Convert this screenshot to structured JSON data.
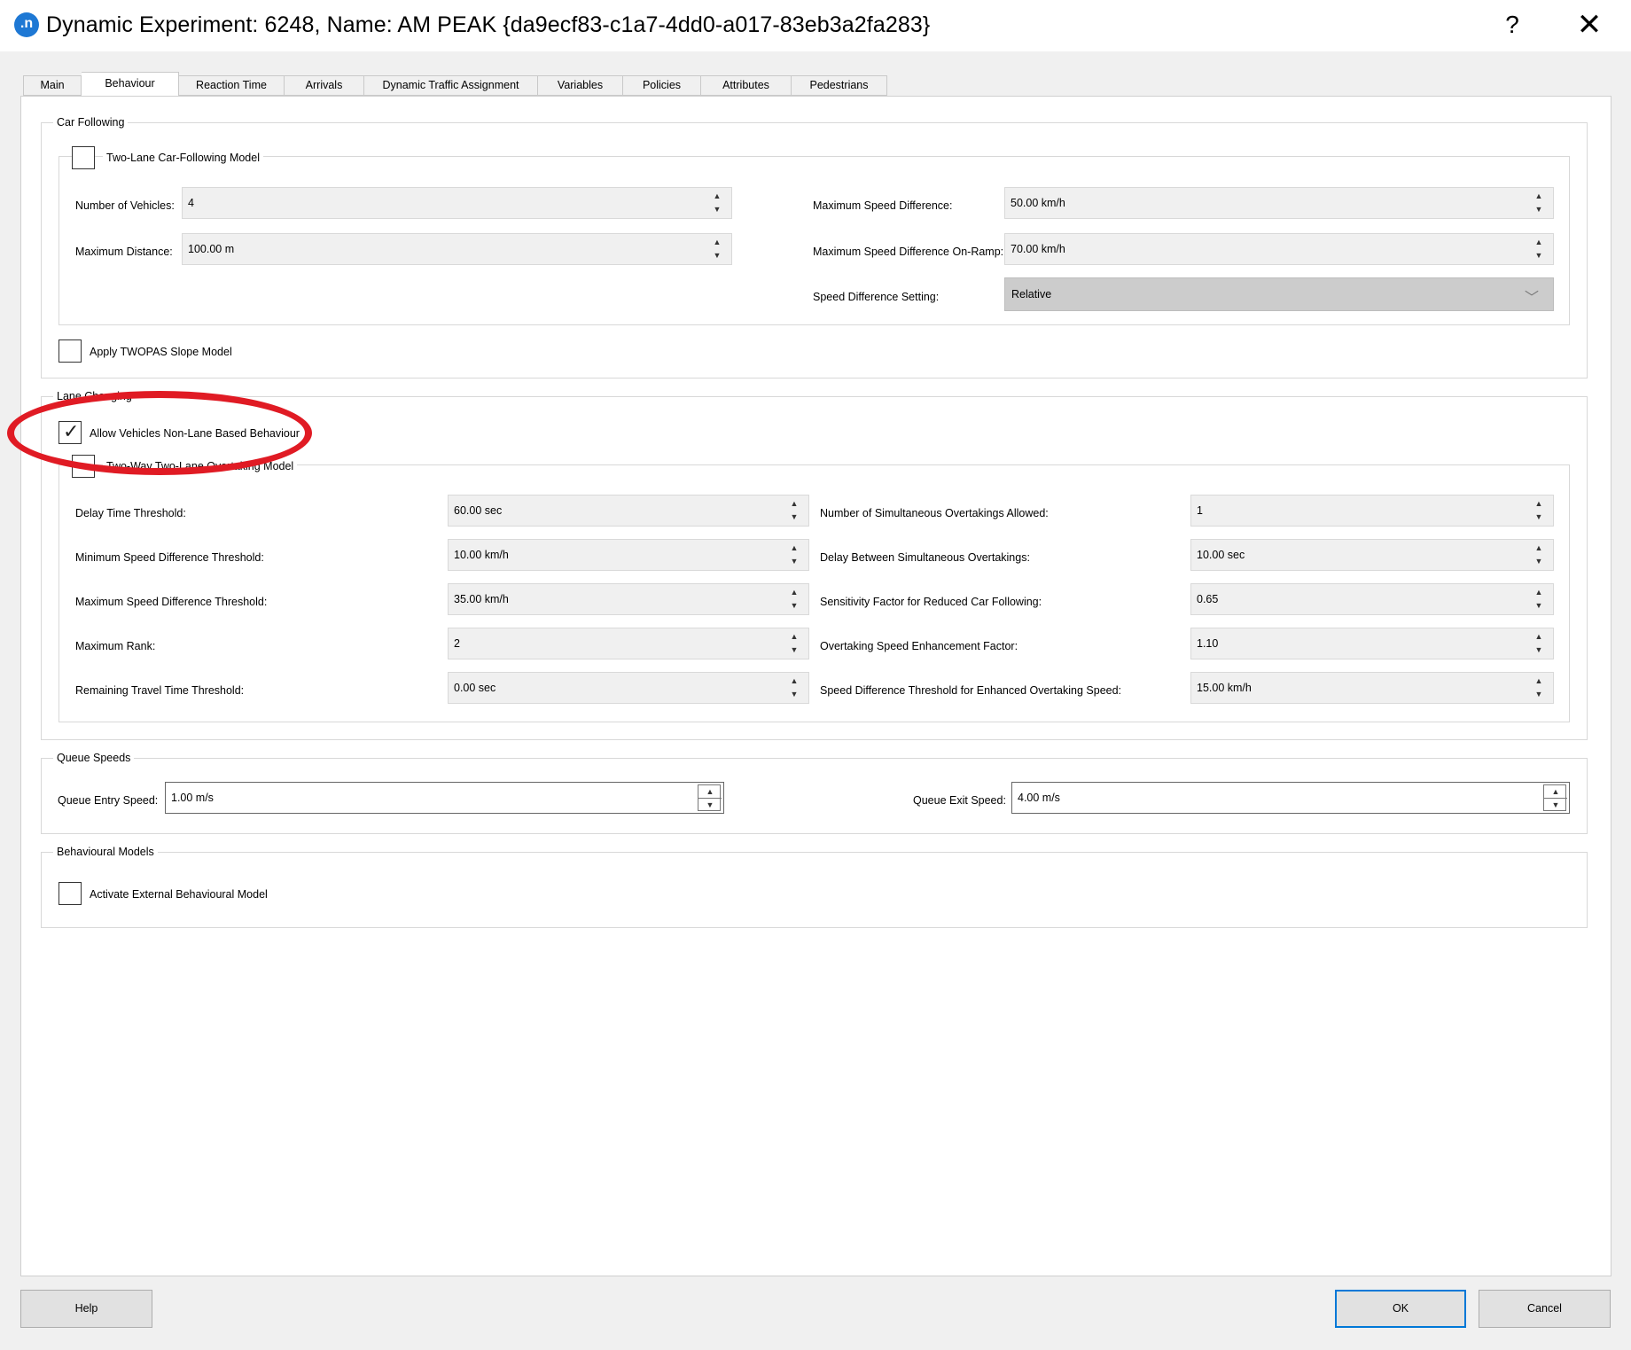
{
  "window": {
    "title": "Dynamic Experiment: 6248, Name: AM PEAK  {da9ecf83-c1a7-4dd0-a017-83eb3a2fa283}",
    "app_icon_text": ".n",
    "help_glyph": "?",
    "close_glyph": "✕"
  },
  "tabs": [
    "Main",
    "Behaviour",
    "Reaction Time",
    "Arrivals",
    "Dynamic Traffic Assignment",
    "Variables",
    "Policies",
    "Attributes",
    "Pedestrians"
  ],
  "active_tab": "Behaviour",
  "car_following": {
    "title": "Car Following",
    "two_lane_label": "Two-Lane Car-Following Model",
    "two_lane_checked": false,
    "num_vehicles_label": "Number of Vehicles:",
    "num_vehicles_value": "4",
    "max_distance_label": "Maximum Distance:",
    "max_distance_value": "100.00 m",
    "max_speed_diff_label": "Maximum Speed Difference:",
    "max_speed_diff_value": "50.00 km/h",
    "max_speed_diff_onramp_label": "Maximum Speed Difference On-Ramp:",
    "max_speed_diff_onramp_value": "70.00 km/h",
    "speed_diff_setting_label": "Speed Difference Setting:",
    "speed_diff_setting_value": "Relative",
    "twopas_label": "Apply TWOPAS Slope Model",
    "twopas_checked": false
  },
  "lane_changing": {
    "title": "Lane Changing",
    "non_lane_label": "Allow Vehicles Non-Lane Based Behaviour",
    "non_lane_checked": true,
    "two_way_label": "Two-Way Two-Lane Overtaking Model",
    "two_way_checked": false,
    "left_fields": [
      {
        "label": "Delay Time Threshold:",
        "value": "60.00 sec"
      },
      {
        "label": "Minimum Speed Difference Threshold:",
        "value": "10.00 km/h"
      },
      {
        "label": "Maximum Speed Difference Threshold:",
        "value": "35.00 km/h"
      },
      {
        "label": "Maximum Rank:",
        "value": "2"
      },
      {
        "label": "Remaining Travel Time Threshold:",
        "value": "0.00 sec"
      }
    ],
    "right_fields": [
      {
        "label": "Number of Simultaneous Overtakings Allowed:",
        "value": "1"
      },
      {
        "label": "Delay Between Simultaneous Overtakings:",
        "value": "10.00 sec"
      },
      {
        "label": "Sensitivity Factor for Reduced Car Following:",
        "value": "0.65"
      },
      {
        "label": "Overtaking Speed Enhancement Factor:",
        "value": "1.10"
      },
      {
        "label": "Speed Difference Threshold for Enhanced Overtaking Speed:",
        "value": "15.00 km/h"
      }
    ]
  },
  "queue_speeds": {
    "title": "Queue Speeds",
    "entry_label": "Queue Entry Speed:",
    "entry_value": "1.00 m/s",
    "exit_label": "Queue Exit Speed:",
    "exit_value": "4.00 m/s"
  },
  "behavioural_models": {
    "title": "Behavioural Models",
    "external_label": "Activate External Behavioural Model",
    "external_checked": false
  },
  "buttons": {
    "help": "Help",
    "ok": "OK",
    "cancel": "Cancel"
  },
  "colors": {
    "highlight_ellipse": "#e01b24",
    "default_button_border": "#0078d7",
    "app_icon": "#1e78d4"
  },
  "spin_up_glyph": "▲",
  "spin_down_glyph": "▼",
  "check_glyph": "✓",
  "chevron_glyph": "﹀"
}
